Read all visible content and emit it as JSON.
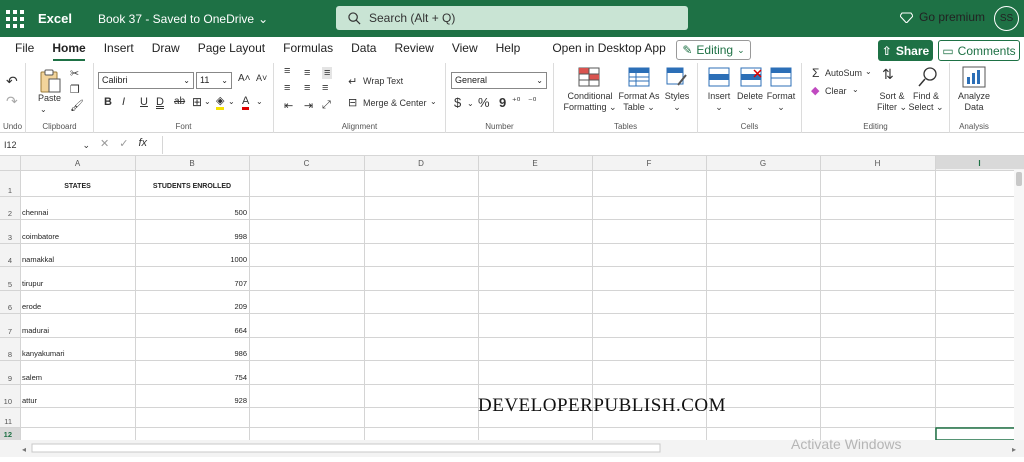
{
  "topbar": {
    "app_name": "Excel",
    "doc_title": "Book 37 - Saved to OneDrive",
    "search_placeholder": "Search (Alt + Q)",
    "premium_label": "Go premium",
    "avatar_initials": "SS",
    "bg_color": "#1e7145"
  },
  "menu": {
    "items": [
      "File",
      "Home",
      "Insert",
      "Draw",
      "Page Layout",
      "Formulas",
      "Data",
      "Review",
      "View",
      "Help",
      "Open in Desktop App"
    ],
    "active": "Home",
    "editing_label": "Editing",
    "share_label": "Share",
    "comments_label": "Comments"
  },
  "ribbon": {
    "undo_group": "Undo",
    "clipboard_group": "Clipboard",
    "paste_label": "Paste",
    "font_group": "Font",
    "font_name": "Calibri",
    "font_size": "11",
    "bold": "B",
    "italic": "I",
    "underline": "U",
    "double_underline": "D",
    "strikethrough": "ab",
    "alignment_group": "Alignment",
    "wrap_text": "Wrap Text",
    "merge_center": "Merge & Center",
    "number_group": "Number",
    "number_format": "General",
    "currency": "$",
    "percent": "%",
    "comma": "9",
    "tables_group": "Tables",
    "conditional_formatting_1": "Conditional",
    "conditional_formatting_2": "Formatting",
    "format_as_table_1": "Format As",
    "format_as_table_2": "Table",
    "styles": "Styles",
    "cells_group": "Cells",
    "insert": "Insert",
    "delete": "Delete",
    "format": "Format",
    "editing_group": "Editing",
    "autosum": "AutoSum",
    "clear": "Clear",
    "sort_filter_1": "Sort &",
    "sort_filter_2": "Filter",
    "find_select_1": "Find &",
    "find_select_2": "Select",
    "analysis_group": "Analysis",
    "analyze_1": "Analyze",
    "analyze_2": "Data"
  },
  "formula_bar": {
    "name_box": "I12",
    "fx": "fx",
    "value": ""
  },
  "sheet": {
    "columns": [
      "A",
      "B",
      "C",
      "D",
      "E",
      "F",
      "G",
      "H",
      "I"
    ],
    "rows": [
      "1",
      "2",
      "3",
      "4",
      "5",
      "6",
      "7",
      "8",
      "9",
      "10",
      "11",
      "12"
    ],
    "header_row": [
      "STATES",
      "STUDENTS ENROLLED"
    ],
    "data": [
      {
        "state": "chennai",
        "enrolled": "500"
      },
      {
        "state": "coimbatore",
        "enrolled": "998"
      },
      {
        "state": "namakkal",
        "enrolled": "1000"
      },
      {
        "state": "tirupur",
        "enrolled": "707"
      },
      {
        "state": "erode",
        "enrolled": "209"
      },
      {
        "state": "madurai",
        "enrolled": "664"
      },
      {
        "state": "kanyakumari",
        "enrolled": "986"
      },
      {
        "state": "salem",
        "enrolled": "754"
      },
      {
        "state": "attur",
        "enrolled": "928"
      }
    ],
    "selected_cell": "I12"
  },
  "overlay": {
    "watermark": "DEVELOPERPUBLISH.COM",
    "activate": "Activate Windows"
  }
}
